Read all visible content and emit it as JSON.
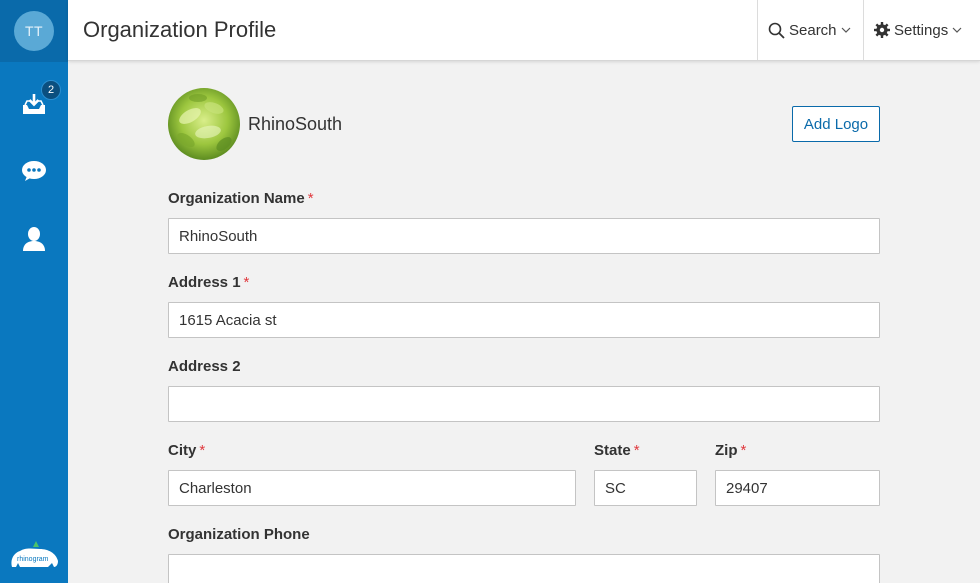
{
  "user": {
    "initials": "TT"
  },
  "sidebar": {
    "inbox_badge": "2",
    "items": [
      {
        "name": "inbox",
        "icon": "inbox-download-icon"
      },
      {
        "name": "chat",
        "icon": "chat-bubble-icon"
      },
      {
        "name": "contacts",
        "icon": "user-icon"
      }
    ],
    "brand_text": "rhinogram"
  },
  "header": {
    "title": "Organization Profile",
    "search_label": "Search",
    "settings_label": "Settings"
  },
  "profile": {
    "org_display_name": "RhinoSouth",
    "add_logo_label": "Add Logo"
  },
  "form": {
    "org_name": {
      "label": "Organization Name",
      "required": "*",
      "value": "RhinoSouth"
    },
    "address1": {
      "label": "Address 1",
      "required": "*",
      "value": "1615 Acacia st"
    },
    "address2": {
      "label": "Address 2",
      "value": ""
    },
    "city": {
      "label": "City",
      "required": "*",
      "value": "Charleston"
    },
    "state": {
      "label": "State",
      "required": "*",
      "value": "SC"
    },
    "zip": {
      "label": "Zip",
      "required": "*",
      "value": "29407"
    },
    "phone": {
      "label": "Organization Phone",
      "value": ""
    }
  },
  "colors": {
    "sidebar": "#0a78bf",
    "accent": "#0a6aaa",
    "required": "#e0393e"
  }
}
